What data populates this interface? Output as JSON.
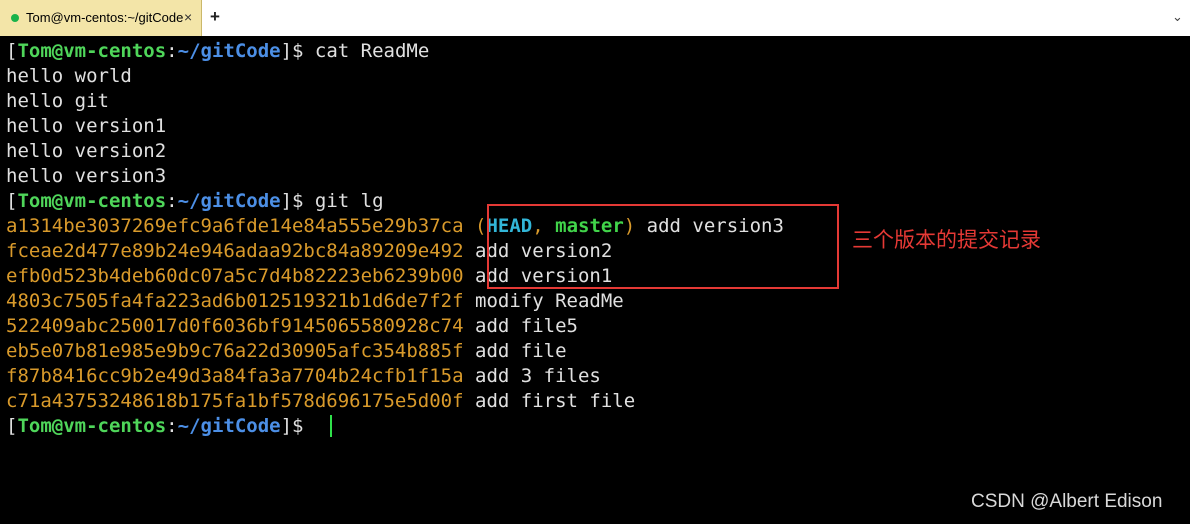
{
  "tab": {
    "title": "Tom@vm-centos:~/gitCode",
    "close_glyph": "×",
    "new_tab_glyph": "+",
    "menu_glyph": "⌄",
    "status_color": "#19b34a"
  },
  "prompt": {
    "open": "[",
    "user": "Tom@vm-centos",
    "colon": ":",
    "path": "~/gitCode",
    "close": "]$ "
  },
  "commands": {
    "cat": "cat ReadMe",
    "git": "git lg"
  },
  "readme_lines": [
    "hello world",
    "hello git",
    "hello version1",
    "hello version2",
    "hello version3"
  ],
  "commits": [
    {
      "hash": "a1314be3037269efc9a6fde14e84a555e29b37ca",
      "ref_head": "HEAD",
      "ref_master": "master",
      "message": "add version3"
    },
    {
      "hash": "fceae2d477e89b24e946adaa92bc84a89209e492",
      "message": "add version2"
    },
    {
      "hash": "efb0d523b4deb60dc07a5c7d4b82223eb6239b00",
      "message": "add version1"
    },
    {
      "hash": "4803c7505fa4fa223ad6b012519321b1d6de7f2f",
      "message": "modify ReadMe"
    },
    {
      "hash": "522409abc250017d0f6036bf9145065580928c74",
      "message": "add file5"
    },
    {
      "hash": "eb5e07b81e985e9b9c76a22d30905afc354b885f",
      "message": "add file"
    },
    {
      "hash": "f87b8416cc9b2e49d3a84fa3a7704b24cfb1f15a",
      "message": "add 3 files"
    },
    {
      "hash": "c71a43753248618b175fa1bf578d696175e5d00f",
      "message": "add first file"
    }
  ],
  "ref_punct": {
    "open": "(",
    "sep": ", ",
    "close": ")"
  },
  "annotation": "三个版本的提交记录",
  "watermark": "CSDN @Albert Edison",
  "colors": {
    "user": "#4fd65a",
    "path": "#4c8fe6",
    "hash": "#d99a2b",
    "head": "#32b6d8",
    "master": "#41d44a",
    "annotation": "#e53935"
  }
}
